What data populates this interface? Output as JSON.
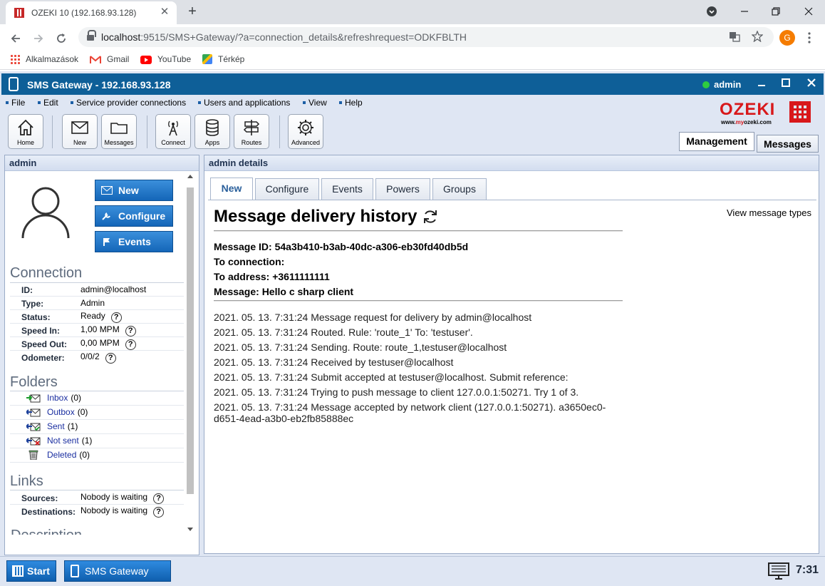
{
  "browser": {
    "tab_title": "OZEKI 10 (192.168.93.128)",
    "tab_close": "✕",
    "new_tab": "+",
    "url_host": "localhost",
    "url_rest": ":9515/SMS+Gateway/?a=connection_details&refreshrequest=ODKFBLTH",
    "profile_initial": "G",
    "bookmarks": [
      {
        "label": "Alkalmazások",
        "icon": "apps-grid-icon"
      },
      {
        "label": "Gmail",
        "icon": "gmail-icon"
      },
      {
        "label": "YouTube",
        "icon": "youtube-icon"
      },
      {
        "label": "Térkép",
        "icon": "maps-icon"
      }
    ]
  },
  "app": {
    "title": "SMS Gateway - 192.168.93.128",
    "user": "admin",
    "menu": [
      "File",
      "Edit",
      "Service provider connections",
      "Users and applications",
      "View",
      "Help"
    ],
    "toolbar": [
      {
        "label": "Home",
        "icon": "home-icon"
      },
      {
        "label": "New",
        "icon": "new-message-icon"
      },
      {
        "label": "Messages",
        "icon": "folder-icon"
      },
      {
        "label": "Connect",
        "icon": "antenna-icon"
      },
      {
        "label": "Apps",
        "icon": "database-icon"
      },
      {
        "label": "Routes",
        "icon": "signpost-icon"
      },
      {
        "label": "Advanced",
        "icon": "gear-icon"
      }
    ],
    "logo": {
      "text": "OZEKI",
      "site_prefix": "www.",
      "site_brand": "my",
      "site_rest": "ozeki.com"
    },
    "main_tabs": [
      "Management",
      "Messages"
    ],
    "active_main_tab": "Messages"
  },
  "left_panel": {
    "title": "admin",
    "buttons": [
      "New",
      "Configure",
      "Events"
    ],
    "connection_title": "Connection",
    "connection": [
      {
        "key": "ID:",
        "value": "admin@localhost",
        "help": false
      },
      {
        "key": "Type:",
        "value": "Admin",
        "help": false
      },
      {
        "key": "Status:",
        "value": "Ready",
        "help": true
      },
      {
        "key": "Speed In:",
        "value": "1,00 MPM",
        "help": true
      },
      {
        "key": "Speed Out:",
        "value": "0,00 MPM",
        "help": true
      },
      {
        "key": "Odometer:",
        "value": "0/0/2",
        "help": true
      }
    ],
    "folders_title": "Folders",
    "folders": [
      {
        "name": "Inbox",
        "count": "(0)"
      },
      {
        "name": "Outbox",
        "count": "(0)"
      },
      {
        "name": "Sent",
        "count": "(1)"
      },
      {
        "name": "Not sent",
        "count": "(1)"
      },
      {
        "name": "Deleted",
        "count": "(0)"
      }
    ],
    "links_title": "Links",
    "links": [
      {
        "key": "Sources:",
        "value": "Nobody is waiting"
      },
      {
        "key": "Destinations:",
        "value": "Nobody is waiting"
      }
    ],
    "description_title": "Description",
    "help_symbol": "?"
  },
  "right_panel": {
    "title": "admin details",
    "tabs": [
      "New",
      "Configure",
      "Events",
      "Powers",
      "Groups"
    ],
    "active_tab": "New",
    "heading": "Message delivery history",
    "view_types_link": "View message types",
    "message_id": "Message ID: 54a3b410-b3ab-40dc-a306-eb30fd40db5d",
    "to_connection": "To connection:",
    "to_address": "To address: +3611111111",
    "message": "Message: Hello c sharp client",
    "log": [
      "2021. 05. 13. 7:31:24 Message request for delivery by admin@localhost",
      "2021. 05. 13. 7:31:24 Routed. Rule: 'route_1' To: 'testuser'.",
      "2021. 05. 13. 7:31:24 Sending. Route: route_1,testuser@localhost",
      "2021. 05. 13. 7:31:24 Received by testuser@localhost",
      "2021. 05. 13. 7:31:24 Submit accepted at testuser@localhost. Submit reference:",
      "2021. 05. 13. 7:31:24 Trying to push message to client 127.0.0.1:50271. Try 1 of 3.",
      "2021. 05. 13. 7:31:24 Message accepted by network client (127.0.0.1:50271). a3650ec0-d651-4ead-a3b0-eb2fb85888ec"
    ]
  },
  "taskbar": {
    "start": "Start",
    "task": "SMS Gateway",
    "clock": "7:31"
  },
  "colors": {
    "titlebar": "#0e5f98",
    "accent_button": "#1466b8",
    "logo_red": "#d8181b"
  }
}
